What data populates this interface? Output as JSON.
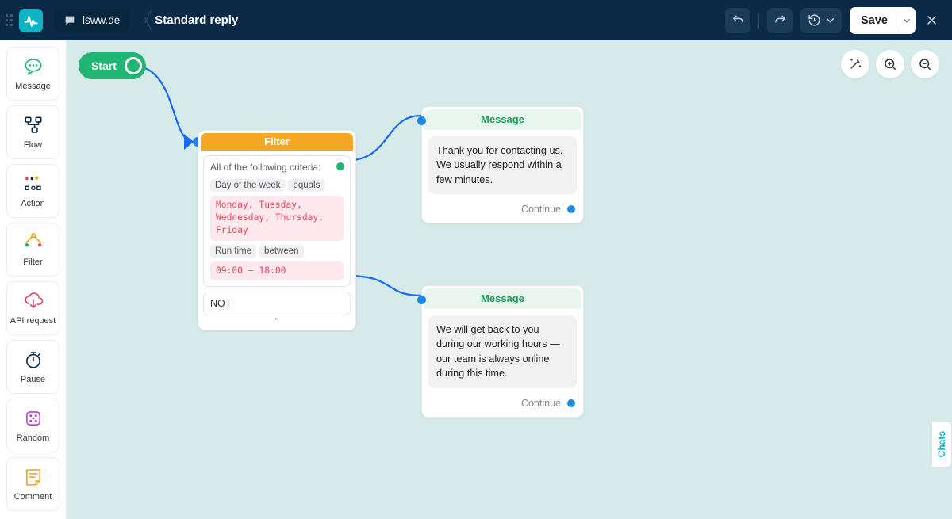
{
  "header": {
    "site_label": "lsww.de",
    "page_title": "Standard reply",
    "save_label": "Save"
  },
  "sidebar": {
    "items": [
      {
        "label": "Message"
      },
      {
        "label": "Flow"
      },
      {
        "label": "Action"
      },
      {
        "label": "Filter"
      },
      {
        "label": "API request"
      },
      {
        "label": "Pause"
      },
      {
        "label": "Random"
      },
      {
        "label": "Comment"
      }
    ]
  },
  "chats_tab": "Chats",
  "nodes": {
    "start": {
      "label": "Start"
    },
    "filter": {
      "title": "Filter",
      "criteria_title": "All of the following criteria:",
      "cond1_field": "Day of the week",
      "cond1_op": "equals",
      "cond1_value": "Monday, Tuesday, Wednesday, Thursday, Friday",
      "cond2_field": "Run time",
      "cond2_op": "between",
      "cond2_value": "09:00 — 18:00",
      "not_label": "NOT",
      "quote": "\""
    },
    "msg_top": {
      "title": "Message",
      "text": "Thank you for contacting us. We usually respond within a few minutes.",
      "continue": "Continue"
    },
    "msg_bot": {
      "title": "Message",
      "text": "We will get back to you during our working hours — our team is always online during this time.",
      "continue": "Continue"
    }
  }
}
